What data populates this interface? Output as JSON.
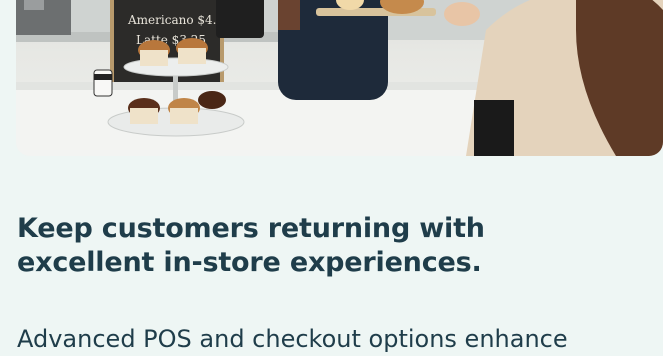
{
  "hero": {
    "image_alt": "Barista handing a pastry to a customer at a bakery counter with cupcake stand"
  },
  "content": {
    "headline_line1": "Keep customers returning with",
    "headline_line2": "excellent in-store experiences.",
    "body_line1": "Advanced POS and checkout options enhance"
  },
  "colors": {
    "background": "#eef6f4",
    "heading_text": "#1f3d4a",
    "body_text": "#1f3d4a"
  }
}
